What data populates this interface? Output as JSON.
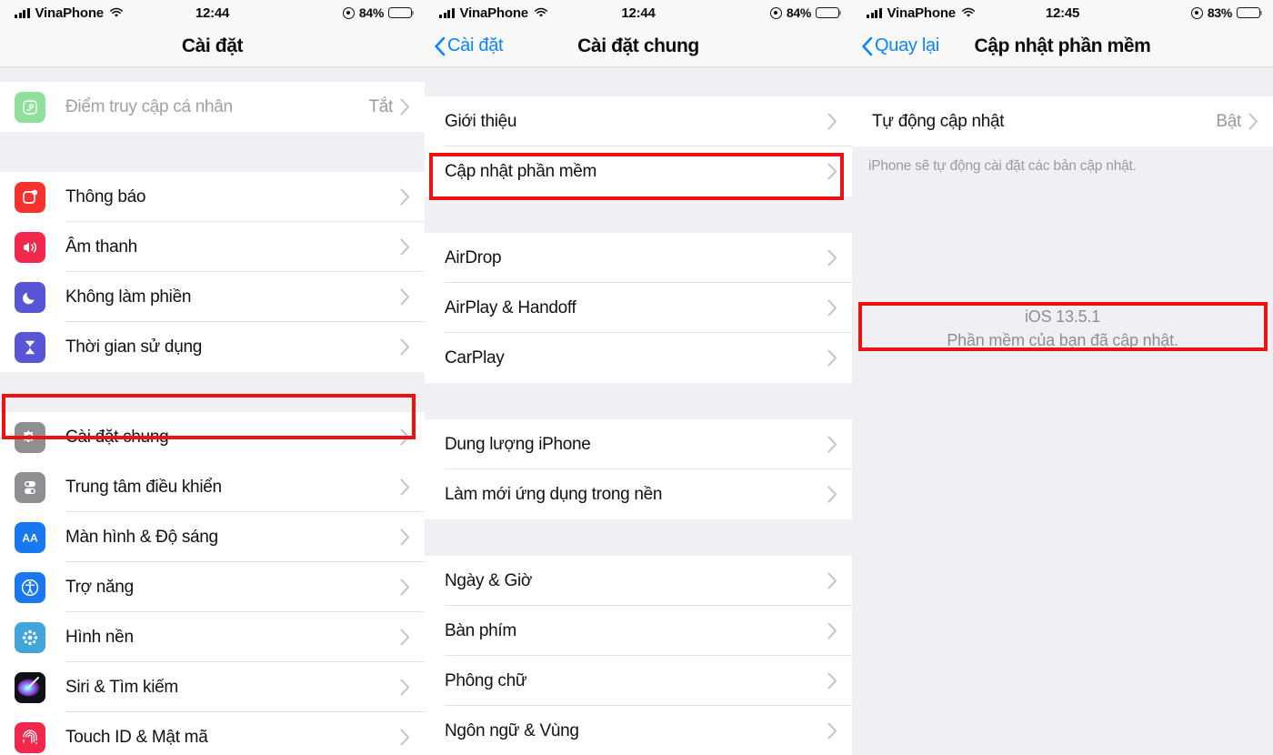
{
  "panels": [
    {
      "id": "settings",
      "statusbar": {
        "carrier": "VinaPhone",
        "time": "12:44",
        "battery_pct": "84%",
        "signal_icon": "cellular-bars-icon",
        "wifi_icon": "wifi-icon",
        "location_icon": "location-services-icon",
        "battery_icon": "battery-icon"
      },
      "nav": {
        "title": "Cài đặt",
        "back_label": null
      },
      "sections": [
        {
          "rows": [
            {
              "label": "Điểm truy cập cá nhân",
              "value": "Tắt",
              "icon": "personal-hotspot-icon",
              "dim": true
            }
          ]
        },
        {
          "rows": [
            {
              "label": "Thông báo",
              "icon": "notifications-icon"
            },
            {
              "label": "Âm thanh",
              "icon": "sounds-icon"
            },
            {
              "label": "Không làm phiền",
              "icon": "do-not-disturb-icon"
            },
            {
              "label": "Thời gian sử dụng",
              "icon": "screen-time-icon"
            }
          ]
        },
        {
          "rows": [
            {
              "label": "Cài đặt chung",
              "icon": "general-gear-icon",
              "highlighted": true
            },
            {
              "label": "Trung tâm điều khiển",
              "icon": "control-center-icon"
            },
            {
              "label": "Màn hình & Độ sáng",
              "icon": "display-brightness-icon"
            },
            {
              "label": "Trợ năng",
              "icon": "accessibility-icon"
            },
            {
              "label": "Hình nền",
              "icon": "wallpaper-icon"
            },
            {
              "label": "Siri & Tìm kiếm",
              "icon": "siri-icon"
            },
            {
              "label": "Touch ID & Mật mã",
              "icon": "touch-id-icon"
            }
          ]
        }
      ]
    },
    {
      "id": "general",
      "statusbar": {
        "carrier": "VinaPhone",
        "time": "12:44",
        "battery_pct": "84%",
        "signal_icon": "cellular-bars-icon",
        "wifi_icon": "wifi-icon",
        "location_icon": "location-services-icon",
        "battery_icon": "battery-icon"
      },
      "nav": {
        "title": "Cài đặt chung",
        "back_label": "Cài đặt"
      },
      "sections": [
        {
          "rows": [
            {
              "label": "Giới thiệu"
            },
            {
              "label": "Cập nhật phần mềm",
              "highlighted": true
            }
          ]
        },
        {
          "rows": [
            {
              "label": "AirDrop"
            },
            {
              "label": "AirPlay & Handoff"
            },
            {
              "label": "CarPlay"
            }
          ]
        },
        {
          "rows": [
            {
              "label": "Dung lượng iPhone"
            },
            {
              "label": "Làm mới ứng dụng trong nền"
            }
          ]
        },
        {
          "rows": [
            {
              "label": "Ngày & Giờ"
            },
            {
              "label": "Bàn phím"
            },
            {
              "label": "Phông chữ"
            },
            {
              "label": "Ngôn ngữ & Vùng"
            }
          ]
        }
      ]
    },
    {
      "id": "software-update",
      "statusbar": {
        "carrier": "VinaPhone",
        "time": "12:45",
        "battery_pct": "83%",
        "signal_icon": "cellular-bars-icon",
        "wifi_icon": "wifi-icon",
        "location_icon": "location-services-icon",
        "battery_icon": "battery-icon"
      },
      "nav": {
        "title": "Cập nhật phần mềm",
        "back_label": "Quay lại"
      },
      "sections": [
        {
          "rows": [
            {
              "label": "Tự động cập nhật",
              "value": "Bật"
            }
          ]
        }
      ],
      "footnote": "iPhone sẽ tự động cài đặt các bản cập nhật.",
      "status_block": {
        "version": "iOS 13.5.1",
        "message": "Phần mềm của bạn đã cập nhật.",
        "highlighted": true
      }
    }
  ],
  "colors": {
    "accent_blue": "#0a84ff",
    "highlight_red": "#ee1111",
    "page_bg": "#f0f0f4",
    "row_bg": "#ffffff",
    "separator": "#e3e3e6",
    "secondary_text": "#9a9aa0"
  }
}
